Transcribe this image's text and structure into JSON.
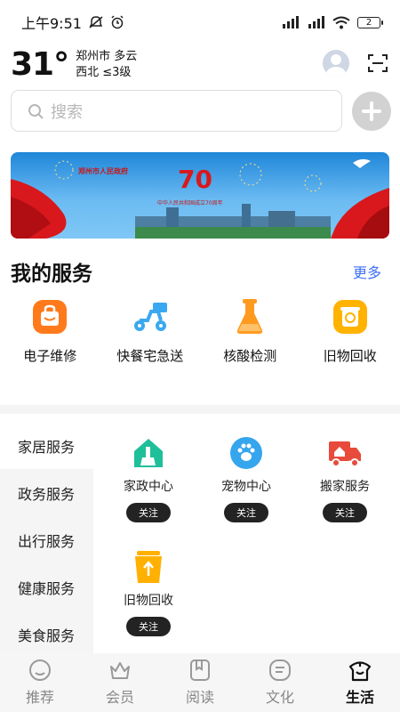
{
  "status_bar": {
    "time": "上午9:51",
    "battery": "2"
  },
  "weather": {
    "temperature": "31°",
    "city_condition": "郑州市 多云",
    "wind": "西北 ≤3级"
  },
  "search": {
    "placeholder": "搜索"
  },
  "banner": {
    "title": "郑州市人民政府",
    "subtitle": "中华人民共和国成立70周年"
  },
  "my_services": {
    "title": "我的服务",
    "more": "更多",
    "items": [
      {
        "label": "电子维修",
        "icon": "bag-icon",
        "color": "#ff7a1a"
      },
      {
        "label": "快餐宅急送",
        "icon": "scooter-icon",
        "color": "#3aa8f0"
      },
      {
        "label": "核酸检测",
        "icon": "flask-icon",
        "color": "#ff9a1f"
      },
      {
        "label": "旧物回收",
        "icon": "recycle-icon",
        "color": "#ffb200"
      }
    ]
  },
  "categories": [
    "家居服务",
    "政务服务",
    "出行服务",
    "健康服务",
    "美食服务"
  ],
  "grid": {
    "follow_label": "关注",
    "items": [
      {
        "label": "家政中心",
        "icon": "house-broom-icon",
        "color": "#1fbf9a"
      },
      {
        "label": "宠物中心",
        "icon": "paw-icon",
        "color": "#35a5ee"
      },
      {
        "label": "搬家服务",
        "icon": "truck-icon",
        "color": "#e84a3c"
      },
      {
        "label": "旧物回收",
        "icon": "recycle-bin-icon",
        "color": "#ffb000"
      }
    ]
  },
  "tabs": [
    {
      "label": "推荐",
      "icon": "smile-icon"
    },
    {
      "label": "会员",
      "icon": "crown-icon"
    },
    {
      "label": "阅读",
      "icon": "book-icon"
    },
    {
      "label": "文化",
      "icon": "scroll-icon"
    },
    {
      "label": "生活",
      "icon": "life-icon",
      "active": true
    }
  ]
}
